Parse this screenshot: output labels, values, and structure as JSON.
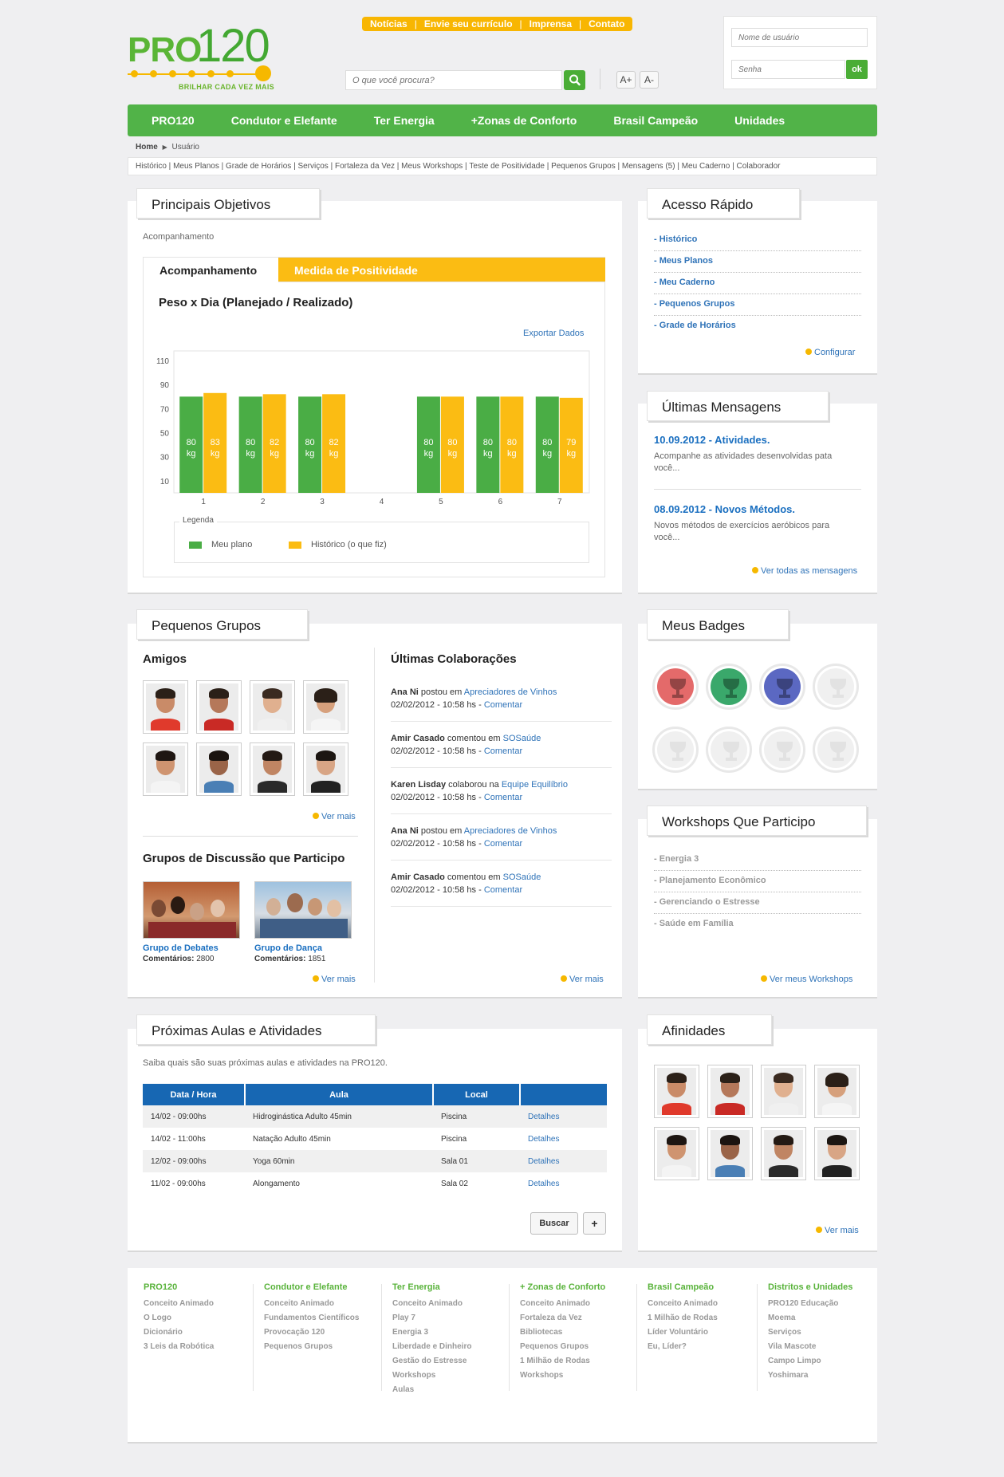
{
  "header": {
    "logo_pro": "PRO",
    "logo_120": "120",
    "slogan": "BRILHAR CADA VEZ MAIS",
    "top_links": [
      "Notícias",
      "Envie seu currículo",
      "Imprensa",
      "Contato"
    ],
    "search_placeholder": "O que você procura?",
    "font_plus": "A+",
    "font_minus": "A-",
    "username_placeholder": "Nome de usuário",
    "password_placeholder": "Senha",
    "ok_label": "ok"
  },
  "nav": [
    "PRO120",
    "Condutor e Elefante",
    "Ter Energia",
    "+Zonas de Conforto",
    "Brasil Campeão",
    "Unidades"
  ],
  "breadcrumb": {
    "home": "Home",
    "arrow": "▶",
    "current": "Usuário"
  },
  "subnav": [
    "Histórico",
    "Meus Planos",
    "Grade de Horários",
    "Serviços",
    "Fortaleza da Vez",
    "Meus Workshops",
    "Teste de Positividade",
    "Pequenos Grupos",
    "Mensagens (5)",
    "Meu Caderno",
    "Colaborador"
  ],
  "objetivos": {
    "title": "Principais Objetivos",
    "subtitle": "Acompanhamento",
    "tab_active": "Acompanhamento",
    "tab_other": "Medida de Positividade",
    "chart_title": "Peso x Dia (Planejado / Realizado)",
    "export_label": "Exportar Dados",
    "legend_title": "Legenda",
    "legend_plan": "Meu plano",
    "legend_hist": "Histórico (o que fiz)"
  },
  "chart_data": {
    "type": "bar",
    "title": "Peso x Dia (Planejado / Realizado)",
    "categories": [
      "1",
      "2",
      "3",
      "4",
      "5",
      "6",
      "7"
    ],
    "yticks": [
      110,
      90,
      70,
      50,
      30,
      10
    ],
    "series": [
      {
        "name": "Meu plano",
        "values": [
          80,
          80,
          80,
          null,
          80,
          80,
          80
        ],
        "color": "#4aad45"
      },
      {
        "name": "Histórico (o que fiz)",
        "values": [
          83,
          82,
          82,
          null,
          80,
          80,
          79
        ],
        "color": "#fbbc13"
      }
    ],
    "unit": "kg"
  },
  "acesso": {
    "title": "Acesso Rápido",
    "links": [
      "- Histórico",
      "- Meus Planos",
      "- Meu Caderno",
      "- Pequenos Grupos",
      "- Grade de Horários"
    ],
    "config": "Configurar"
  },
  "mensagens": {
    "title": "Últimas Mensagens",
    "items": [
      {
        "title": "10.09.2012 - Atividades.",
        "text": "Acompanhe as atividades desenvolvidas pata você..."
      },
      {
        "title": "08.09.2012 - Novos Métodos.",
        "text": "Novos métodos de exercícios aeróbicos para você..."
      }
    ],
    "more": "Ver todas as mensagens"
  },
  "grupos": {
    "title": "Pequenos Grupos",
    "amigos_title": "Amigos",
    "ver_mais": "Ver mais",
    "discussao_title": "Grupos de Discussão que Participo",
    "groups": [
      {
        "name": "Grupo de Debates",
        "label": "Comentários:",
        "count": "2800"
      },
      {
        "name": "Grupo de Dança",
        "label": "Comentários:",
        "count": "1851"
      }
    ],
    "colab_title": "Últimas Colaborações",
    "colabs": [
      {
        "user": "Ana Ni",
        "action": "postou em",
        "target": "Apreciadores de Vinhos",
        "date": "02/02/2012 - 10:58 hs -",
        "link": "Comentar"
      },
      {
        "user": "Amir Casado",
        "action": "comentou em",
        "target": "SOSaúde",
        "date": "02/02/2012 - 10:58 hs -",
        "link": "Comentar"
      },
      {
        "user": "Karen Lisday",
        "action": "colaborou na",
        "target": "Equipe Equilíbrio",
        "date": "02/02/2012 - 10:58 hs -",
        "link": "Comentar"
      },
      {
        "user": "Ana Ni",
        "action": "postou em",
        "target": "Apreciadores de Vinhos",
        "date": "02/02/2012 - 10:58 hs -",
        "link": "Comentar"
      },
      {
        "user": "Amir Casado",
        "action": "comentou em",
        "target": "SOSaúde",
        "date": "02/02/2012 - 10:58 hs -",
        "link": "Comentar"
      }
    ]
  },
  "badges": {
    "title": "Meus Badges",
    "colors": [
      "#e46a6a",
      "#3aa86b",
      "#5b68c2",
      "#f0f0f0",
      "#f0f0f0",
      "#f0f0f0",
      "#f0f0f0",
      "#f0f0f0"
    ]
  },
  "workshops": {
    "title": "Workshops Que Participo",
    "items": [
      "- Energia 3",
      "- Planejamento Econômico",
      "- Gerenciando o Estresse",
      "- Saúde em Família"
    ],
    "more": "Ver meus Workshops"
  },
  "aulas": {
    "title": "Próximas Aulas e Atividades",
    "intro": "Saiba quais são suas próximas aulas e atividades na PRO120.",
    "headers": [
      "Data / Hora",
      "Aula",
      "Local",
      ""
    ],
    "rows": [
      [
        "14/02 - 09:00hs",
        "Hidroginástica Adulto 45min",
        "Piscina",
        "Detalhes"
      ],
      [
        "14/02 - 11:00hs",
        "Natação Adulto 45min",
        "Piscina",
        "Detalhes"
      ],
      [
        "12/02 - 09:00hs",
        "Yoga 60min",
        "Sala 01",
        "Detalhes"
      ],
      [
        "11/02 - 09:00hs",
        "Alongamento",
        "Sala 02",
        "Detalhes"
      ]
    ],
    "buscar": "Buscar",
    "plus": "+"
  },
  "afinidades": {
    "title": "Afinidades",
    "more": "Ver mais"
  },
  "footer": [
    {
      "heading": "PRO120",
      "items": [
        "Conceito Animado",
        "O Logo",
        "Dicionário",
        "3 Leis da Robótica"
      ]
    },
    {
      "heading": "Condutor e Elefante",
      "items": [
        "Conceito Animado",
        "Fundamentos Científicos",
        "Provocação 120",
        "Pequenos Grupos"
      ]
    },
    {
      "heading": "Ter Energia",
      "items": [
        "Conceito Animado",
        "Play 7",
        "Energia 3",
        "Liberdade e Dinheiro",
        "Gestão do Estresse",
        "Workshops",
        "Aulas"
      ]
    },
    {
      "heading": "+ Zonas de Conforto",
      "items": [
        "Conceito Animado",
        "Fortaleza da Vez",
        "Bibliotecas",
        "Pequenos Grupos",
        "1 Milhão de Rodas",
        "Workshops"
      ]
    },
    {
      "heading": "Brasil Campeão",
      "items": [
        "Conceito Animado",
        "1 Milhão de Rodas",
        "Líder Voluntário",
        "Eu, Líder?"
      ]
    },
    {
      "heading": "Distritos e Unidades",
      "items": [
        "PRO120 Educação",
        "Moema",
        "Serviços",
        "Vila Mascote",
        "Campo Limpo",
        "Yoshimara"
      ]
    }
  ]
}
